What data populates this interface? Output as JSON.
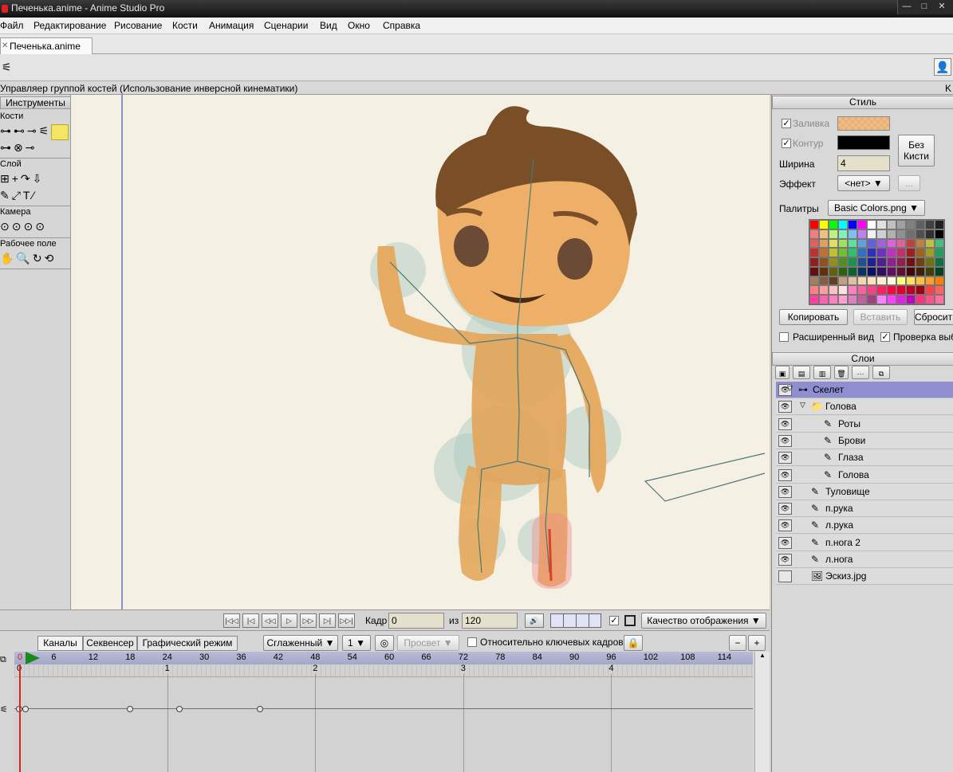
{
  "window": {
    "title": "Печенька.anime - Anime Studio Pro",
    "controls": [
      "—",
      "□",
      "✕"
    ]
  },
  "menu": [
    "Файл",
    "Редактирование",
    "Рисование",
    "Кости",
    "Анимация",
    "Сценарии",
    "Вид",
    "Окно",
    "Справка"
  ],
  "document_tab": {
    "label": "Печенька.anime",
    "close": "✕"
  },
  "status_text": "Управляер группой костей (Использование инверсной кинематики)",
  "status_right": "K",
  "tools_panel": {
    "header": "Инструменты",
    "sections": {
      "bones": "Кости",
      "layer": "Слой",
      "camera": "Камера",
      "workspace": "Рабочее поле"
    },
    "bone_row1": "⊶⊷⊸⚟",
    "bone_row2": "⊶⊗⊸",
    "layer_row1": "⊞+↷⇩",
    "layer_row2": "✎⤢T∕",
    "camera_row": "⊙⊙⊙⊙",
    "workspace_row": "✋🔍↻⟲"
  },
  "style_panel": {
    "header": "Стиль",
    "fill_label": "Заливка",
    "stroke_label": "Контур",
    "width_label": "Ширина",
    "width_value": "4",
    "no_brush": "Без Кисти",
    "effect_label": "Эффект",
    "effect_value": "<нет>",
    "more_btn": "...",
    "palettes_label": "Палитры",
    "palette_value": "Basic Colors.png",
    "copy_btn": "Копировать",
    "paste_btn": "Вставить",
    "reset_btn": "Сбросить",
    "advanced_label": "Расширенный вид",
    "check_label": "Проверка выбора",
    "colors": {
      "fill": "#f0b070",
      "stroke": "#000000"
    }
  },
  "layers_panel": {
    "header": "Слои",
    "toolbar_more": "···",
    "layers": [
      {
        "name": "Скелет",
        "indent": 1,
        "icon": "bone",
        "selected": true,
        "expander": "▽"
      },
      {
        "name": "Голова",
        "indent": 2,
        "icon": "folder",
        "selected": false,
        "expander": "▽"
      },
      {
        "name": "Роты",
        "indent": 3,
        "icon": "vector"
      },
      {
        "name": "Брови",
        "indent": 3,
        "icon": "vector"
      },
      {
        "name": "Глаза",
        "indent": 3,
        "icon": "vector"
      },
      {
        "name": "Голова",
        "indent": 3,
        "icon": "vector"
      },
      {
        "name": "Туловище",
        "indent": 2,
        "icon": "vector"
      },
      {
        "name": "п.рука",
        "indent": 2,
        "icon": "vector"
      },
      {
        "name": "л.рука",
        "indent": 2,
        "icon": "vector"
      },
      {
        "name": "п.нога  2",
        "indent": 2,
        "icon": "vector"
      },
      {
        "name": "л.нога",
        "indent": 2,
        "icon": "vector"
      },
      {
        "name": "Эскиз.jpg",
        "indent": 2,
        "icon": "image"
      }
    ]
  },
  "playback": {
    "frame_label": "Кадр",
    "frame_value": "0",
    "of_label": "из",
    "total_frames": "120",
    "quality_label": "Качество отображения",
    "buttons": [
      "|◁◁",
      "|◁",
      "◁◁",
      "▷",
      "▷▷",
      "▷|",
      "▷▷|"
    ]
  },
  "timeline": {
    "tabs": [
      "Каналы",
      "Секвенсер",
      "Графический режим"
    ],
    "interpolation": "Сглаженный",
    "interval": "1",
    "onion": "Просвет",
    "relative_keys": "Относительно ключевых кадров",
    "ruler_ticks": [
      "0",
      "6",
      "12",
      "18",
      "24",
      "30",
      "36",
      "42",
      "48",
      "54",
      "60",
      "66",
      "72",
      "78",
      "84",
      "90",
      "96",
      "102",
      "108",
      "114"
    ],
    "seconds": [
      "0",
      "1",
      "2",
      "3",
      "4"
    ]
  }
}
